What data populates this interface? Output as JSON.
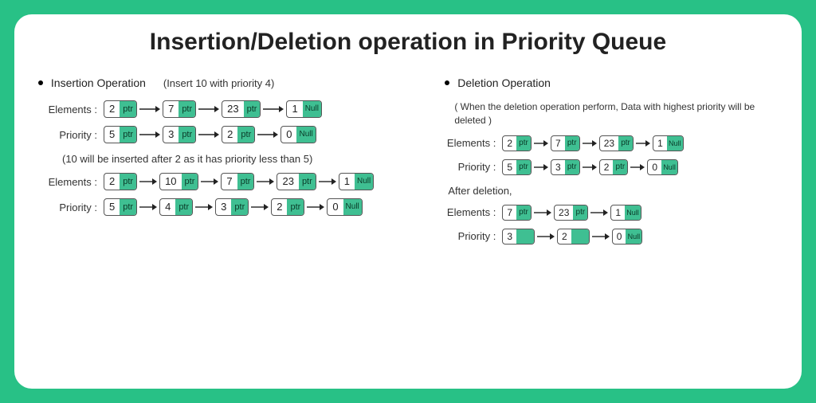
{
  "title": "Insertion/Deletion operation in Priority Queue",
  "labels": {
    "elements": "Elements :",
    "priority": "Priority :",
    "ptr": "ptr",
    "null": "Null"
  },
  "insertion": {
    "headerName": "Insertion Operation",
    "headerHint": "(Insert 10 with priority 4)",
    "beforeElements": [
      2,
      7,
      23,
      1
    ],
    "beforePriority": [
      5,
      3,
      2,
      0
    ],
    "note": "(10 will be inserted after 2 as it has priority less than 5)",
    "afterElements": [
      2,
      10,
      7,
      23,
      1
    ],
    "afterPriority": [
      5,
      4,
      3,
      2,
      0
    ]
  },
  "deletion": {
    "headerName": "Deletion Operation",
    "subnote": "( When the deletion operation perform, Data with highest priority will be deleted )",
    "beforeElements": [
      2,
      7,
      23,
      1
    ],
    "beforePriority": [
      5,
      3,
      2,
      0
    ],
    "afterLabel": "After deletion,",
    "afterElements": [
      7,
      23,
      1
    ],
    "afterPriority": [
      3,
      2,
      0
    ]
  }
}
